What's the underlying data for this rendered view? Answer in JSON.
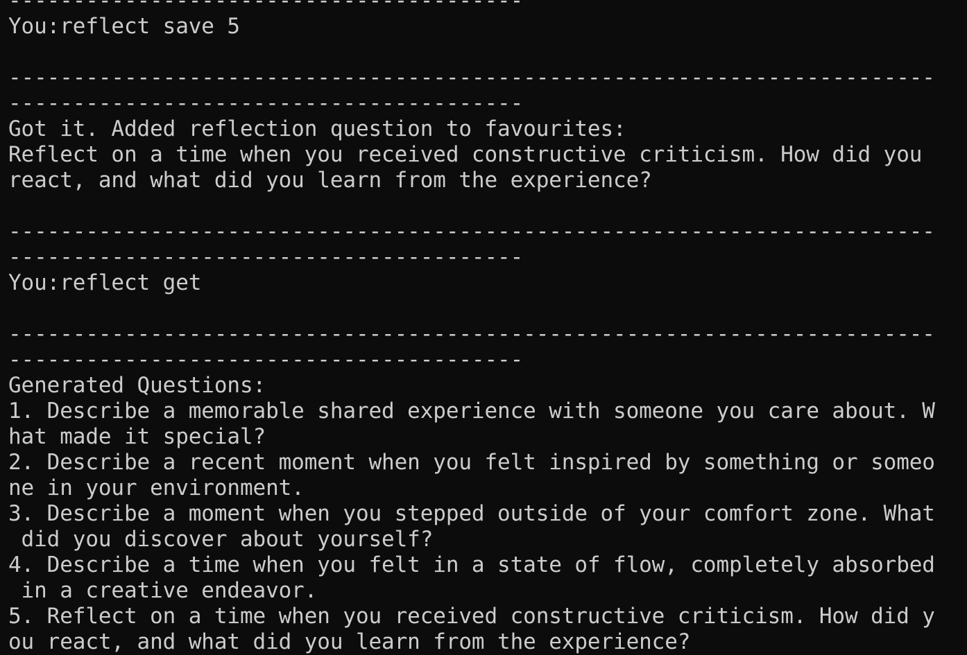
{
  "terminal": {
    "lines": [
      "----------------------------------------",
      "You:reflect save 5",
      "",
      "------------------------------------------------------------------------",
      "----------------------------------------",
      "Got it. Added reflection question to favourites:",
      "Reflect on a time when you received constructive criticism. How did you",
      "react, and what did you learn from the experience?",
      "",
      "------------------------------------------------------------------------",
      "----------------------------------------",
      "You:reflect get",
      "",
      "------------------------------------------------------------------------",
      "----------------------------------------",
      "Generated Questions:",
      "1. Describe a memorable shared experience with someone you care about. W",
      "hat made it special?",
      "2. Describe a recent moment when you felt inspired by something or someo",
      "ne in your environment.",
      "3. Describe a moment when you stepped outside of your comfort zone. What",
      " did you discover about yourself?",
      "4. Describe a time when you felt in a state of flow, completely absorbed",
      " in a creative endeavor.",
      "5. Reflect on a time when you received constructive criticism. How did y",
      "ou react, and what did you learn from the experience?"
    ]
  }
}
